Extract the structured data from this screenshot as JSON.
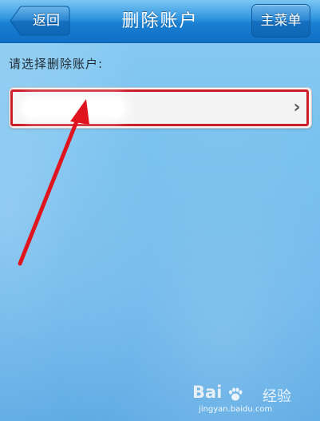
{
  "header": {
    "title": "删除账户",
    "back_label": "返回",
    "menu_label": "主菜单"
  },
  "prompt": "请选择删除账户:",
  "account_row": {
    "chevron": "›"
  },
  "watermark": {
    "logo": "Bai",
    "logo_suffix": "经验",
    "url": "jingyan.baidu.com"
  },
  "colors": {
    "header": "#1a7fd1",
    "highlight": "#cc1f2a",
    "background": "#78c1ef"
  }
}
